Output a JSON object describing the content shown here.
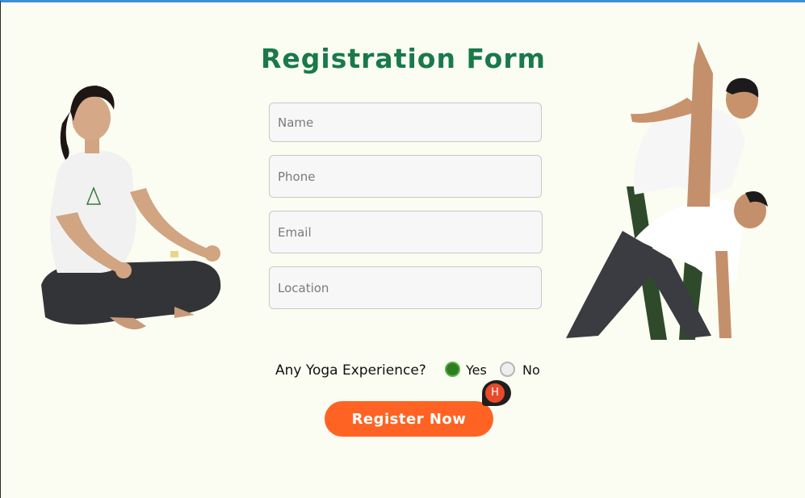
{
  "page": {
    "title": "Registration Form"
  },
  "form": {
    "name_placeholder": "Name",
    "phone_placeholder": "Phone",
    "email_placeholder": "Email",
    "location_placeholder": "Location",
    "experience_label": "Any Yoga Experience?",
    "option_yes": "Yes",
    "option_no": "No",
    "selected_option": "Yes",
    "submit_label": "Register Now"
  },
  "cursor_badge": {
    "letter": "H"
  },
  "colors": {
    "title_green": "#19794a",
    "button_orange": "#ff6324",
    "radio_selected": "#2e7d1e",
    "top_border_blue": "#3f8fd8",
    "background": "#fbfdf2"
  }
}
